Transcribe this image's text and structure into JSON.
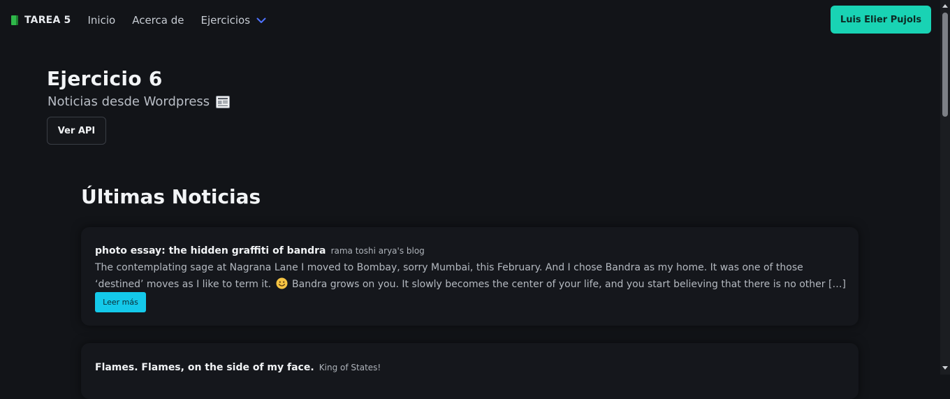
{
  "navbar": {
    "brand": "TAREA 5",
    "links": [
      "Inicio",
      "Acerca de"
    ],
    "dropdown_label": "Ejercicios",
    "user_button": "Luis Elier Pujols",
    "brand_icon": "book-icon",
    "accent": "#19d3b4"
  },
  "header": {
    "title": "Ejercicio 6",
    "subtitle": "Noticias desde Wordpress",
    "subtitle_icon": "newspaper-icon",
    "api_button": "Ver API"
  },
  "news": {
    "section_title": "Últimas Noticias",
    "items": [
      {
        "title": "photo essay: the hidden graffiti of bandra",
        "source": "rama toshi arya's blog",
        "excerpt_before": "The contemplating sage at Nagrana Lane I moved to Bombay, sorry Mumbai, this February. And I chose Bandra as my home. It was one of those ‘destined’ moves as I like to term it.",
        "excerpt_after": "Bandra grows on you. It slowly becomes the center of your life, and you start believing that there is no other […]",
        "read_more": "Leer más"
      },
      {
        "title": "Flames. Flames, on the side of my face.",
        "source": "King of States!"
      }
    ],
    "read_more_color": "#14c9ea"
  }
}
